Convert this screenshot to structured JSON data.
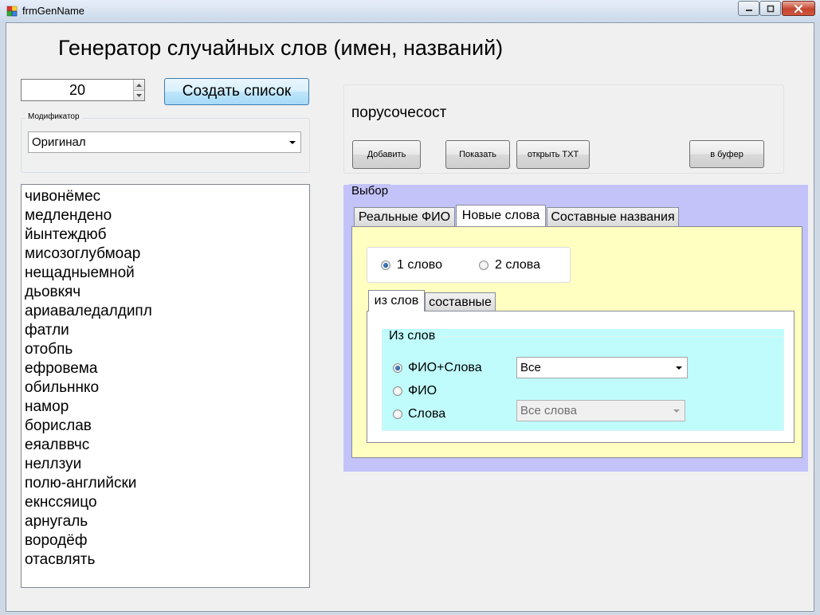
{
  "window": {
    "title": "frmGenName"
  },
  "heading": "Генератор случайных слов (имен, названий)",
  "count": {
    "value": "20"
  },
  "create_button": "Создать список",
  "modifier": {
    "label": "Модификатор",
    "selected": "Оригинал"
  },
  "word_list": [
    "чивонёмес",
    "медлендено",
    "йынтеждюб",
    "мисозоглубмоар",
    "нещадныемной",
    "дьовкяч",
    "ариаваледалдипл",
    "фатли",
    "отобпь",
    "ефровема",
    "обильннко",
    "намор",
    "борислав",
    "еяалввчс",
    "неллзуи",
    "полю-английски",
    "екнссяицо",
    "арнугаль",
    "вородёф",
    "отасвлять"
  ],
  "output": {
    "word": "порусочесост",
    "buttons": {
      "add": "Добавить",
      "show": "Показать",
      "open_txt": "открыть TXT",
      "to_clipboard": "в буфер"
    }
  },
  "selection": {
    "label": "Выбор",
    "tabs": [
      "Реальные ФИО",
      "Новые слова",
      "Составные названия"
    ],
    "active_tab": "Новые слова",
    "word_count_options": [
      "1 слово",
      "2 слова"
    ],
    "word_count_selected": "1 слово",
    "subtabs": [
      "из слов",
      "составные"
    ],
    "active_subtab": "из слов",
    "from_words": {
      "label": "Из слов",
      "source_options": [
        "ФИО+Слова",
        "ФИО",
        "Слова"
      ],
      "source_selected": "ФИО+Слова",
      "combo_all": "Все",
      "combo_words": "Все слова"
    }
  },
  "colors": {
    "selection_bg": "#c3c3fa",
    "tabpage_bg": "#ffffc2",
    "from_words_bg": "#c0fcfc",
    "close_button": "#c6452f"
  }
}
